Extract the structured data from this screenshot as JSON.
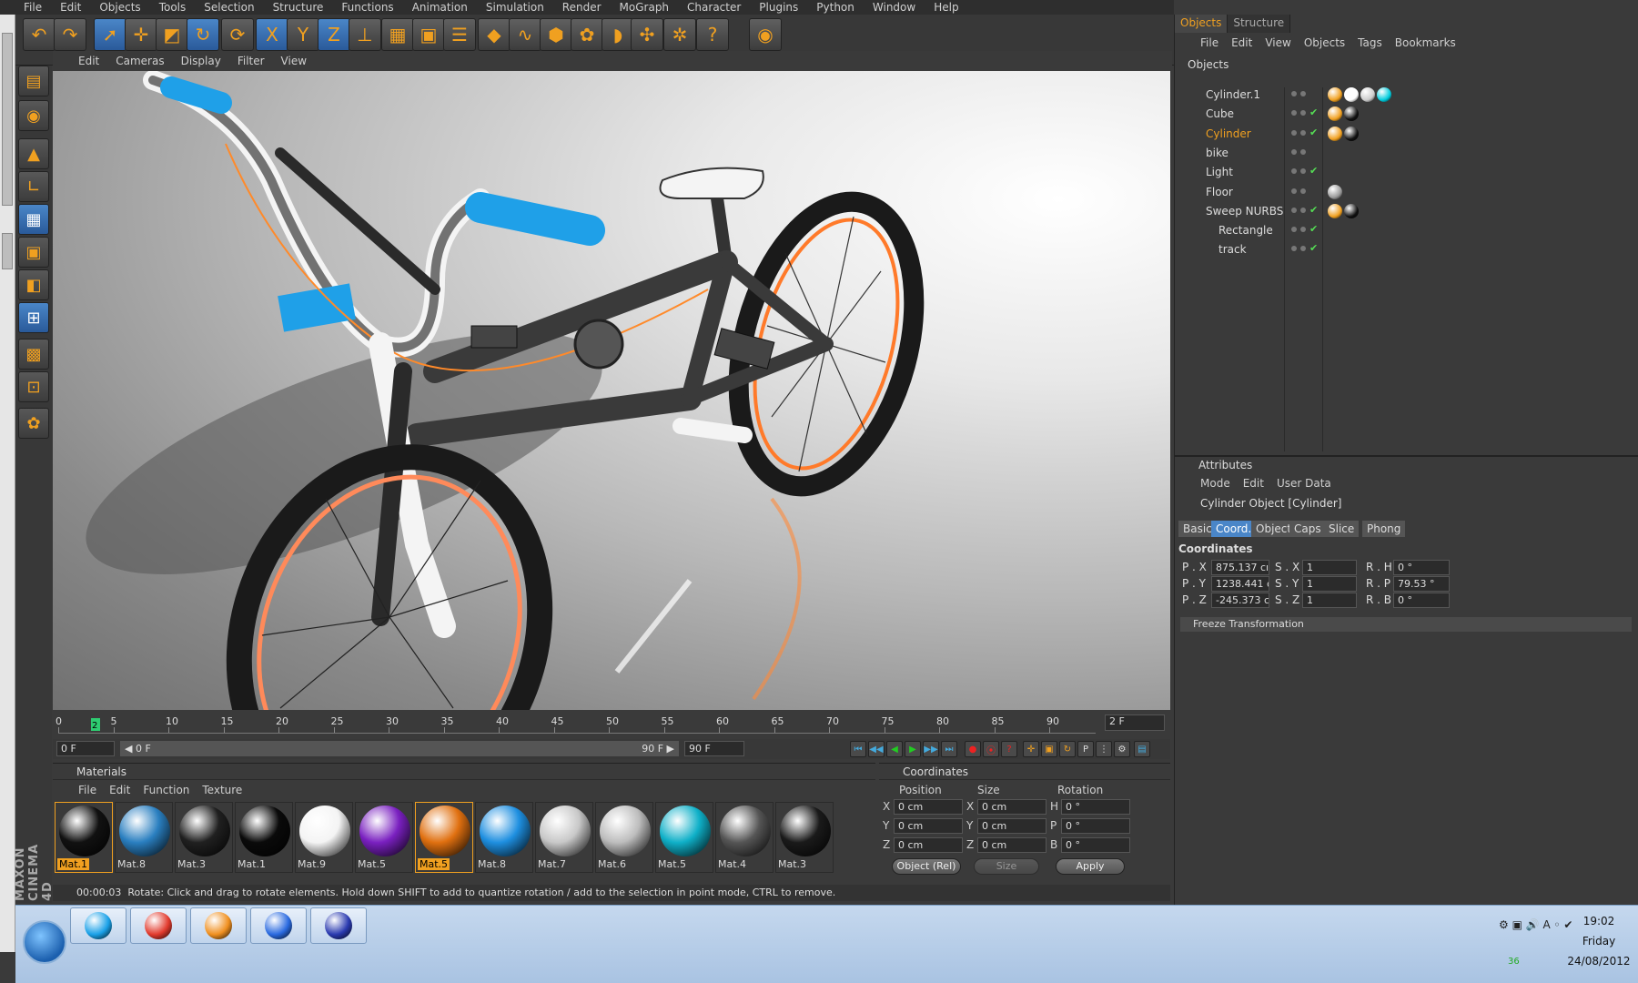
{
  "menubar": [
    "File",
    "Edit",
    "Objects",
    "Tools",
    "Selection",
    "Structure",
    "Functions",
    "Animation",
    "Simulation",
    "Render",
    "MoGraph",
    "Character",
    "Plugins",
    "Python",
    "Window",
    "Help"
  ],
  "toolbar_icons": [
    "undo-icon",
    "redo-icon",
    "live-select-icon",
    "move-icon",
    "scale-icon",
    "rotate-icon",
    "rotate-alt-icon",
    "x-axis-icon",
    "y-axis-icon",
    "z-axis-icon",
    "coordinate-system-icon",
    "render-view-icon",
    "render-picture-viewer-icon",
    "render-settings-icon",
    "cube-icon",
    "spline-icon",
    "nurbs-icon",
    "array-icon",
    "deformer-icon",
    "scene-icon",
    "camera-light-icon",
    "help-icon",
    "cinema4d-icon"
  ],
  "viewport_menu": [
    "Edit",
    "Cameras",
    "Display",
    "Filter",
    "View"
  ],
  "timeline": {
    "ticks": [
      "0",
      "5",
      "10",
      "15",
      "20",
      "25",
      "30",
      "35",
      "40",
      "45",
      "50",
      "55",
      "60",
      "65",
      "70",
      "75",
      "80",
      "85",
      "90"
    ],
    "playhead_label": "2",
    "current_frame": "2 F",
    "start_field": "0 F",
    "range_start": "◀ 0 F",
    "range_end": "90 F ▶",
    "end_field": "90 F"
  },
  "materials": {
    "title": "Materials",
    "menu": [
      "File",
      "Edit",
      "Function",
      "Texture"
    ],
    "items": [
      {
        "name": "Mat.1",
        "color": "#111111",
        "sel": true
      },
      {
        "name": "Mat.8",
        "color": "#2a7fc0",
        "sel": false
      },
      {
        "name": "Mat.3",
        "color": "#202020",
        "sel": false
      },
      {
        "name": "Mat.1",
        "color": "#0a0a0a",
        "sel": false
      },
      {
        "name": "Mat.9",
        "color": "#f4f4f4",
        "sel": false
      },
      {
        "name": "Mat.5",
        "color": "#7a20c0",
        "sel": false
      },
      {
        "name": "Mat.5",
        "color": "#e07010",
        "sel": true
      },
      {
        "name": "Mat.8",
        "color": "#1e8fe0",
        "sel": false
      },
      {
        "name": "Mat.7",
        "color": "#c8c8c8",
        "sel": false
      },
      {
        "name": "Mat.6",
        "color": "#bdbdbd",
        "sel": false
      },
      {
        "name": "Mat.5",
        "color": "#0fb0c8",
        "sel": false
      },
      {
        "name": "Mat.4",
        "color": "#555555",
        "sel": false
      },
      {
        "name": "Mat.3",
        "color": "#1a1a1a",
        "sel": false
      }
    ]
  },
  "coordinates": {
    "title": "Coordinates",
    "headers": [
      "Position",
      "Size",
      "Rotation"
    ],
    "rows": [
      {
        "axis": "X",
        "pos": "0 cm",
        "saxis": "X",
        "size": "0 cm",
        "raxis": "H",
        "rot": "0 °"
      },
      {
        "axis": "Y",
        "pos": "0 cm",
        "saxis": "Y",
        "size": "0 cm",
        "raxis": "P",
        "rot": "0 °"
      },
      {
        "axis": "Z",
        "pos": "0 cm",
        "saxis": "Z",
        "size": "0 cm",
        "raxis": "B",
        "rot": "0 °"
      }
    ],
    "mode": "Object (Rel)",
    "size_mode": "Size",
    "apply": "Apply"
  },
  "status": {
    "time": "00:00:03",
    "message": "Rotate: Click and drag to rotate elements. Hold down SHIFT to add to quantize rotation / add to the selection in point mode, CTRL to remove."
  },
  "brand": "MAXON CINEMA 4D",
  "object_manager": {
    "tabs": [
      "Objects",
      "Structure"
    ],
    "menu": [
      "File",
      "Edit",
      "View",
      "Objects",
      "Tags",
      "Bookmarks"
    ],
    "header": "Objects",
    "objects": [
      {
        "name": "Cylinder.1",
        "indent": 0,
        "sel": false,
        "check": false
      },
      {
        "name": "Cube",
        "indent": 0,
        "sel": false,
        "check": true
      },
      {
        "name": "Cylinder",
        "indent": 0,
        "sel": true,
        "check": true
      },
      {
        "name": "bike",
        "indent": 0,
        "sel": false,
        "check": false
      },
      {
        "name": "Light",
        "indent": 0,
        "sel": false,
        "check": true
      },
      {
        "name": "Floor",
        "indent": 0,
        "sel": false,
        "check": false
      },
      {
        "name": "Sweep NURBS",
        "indent": 0,
        "sel": false,
        "check": true
      },
      {
        "name": "Rectangle",
        "indent": 1,
        "sel": false,
        "check": true
      },
      {
        "name": "track",
        "indent": 1,
        "sel": false,
        "check": true
      }
    ]
  },
  "attributes": {
    "title": "Attributes",
    "menu": [
      "Mode",
      "Edit",
      "User Data"
    ],
    "object_title": "Cylinder Object [Cylinder]",
    "tabs": [
      "Basic",
      "Coord.",
      "Object",
      "Caps",
      "Slice",
      "Phong"
    ],
    "active_tab": "Coord.",
    "section": "Coordinates",
    "rows": [
      {
        "pl": "P . X",
        "pv": "875.137 cı",
        "sl": "S . X",
        "sv": "1",
        "rl": "R . H",
        "rv": "0 °"
      },
      {
        "pl": "P . Y",
        "pv": "1238.441 c",
        "sl": "S . Y",
        "sv": "1",
        "rl": "R . P",
        "rv": "79.53 °"
      },
      {
        "pl": "P . Z",
        "pv": "-245.373 c",
        "sl": "S . Z",
        "sv": "1",
        "rl": "R . B",
        "rv": "0 °"
      }
    ],
    "freeze": "Freeze Transformation"
  },
  "taskbar": {
    "apps": [
      "skype-icon",
      "chrome-icon",
      "firefox-icon",
      "itunes-icon",
      "blender-icon"
    ],
    "tray_badge": "36",
    "time": "19:02",
    "day": "Friday",
    "date": "24/08/2012"
  }
}
